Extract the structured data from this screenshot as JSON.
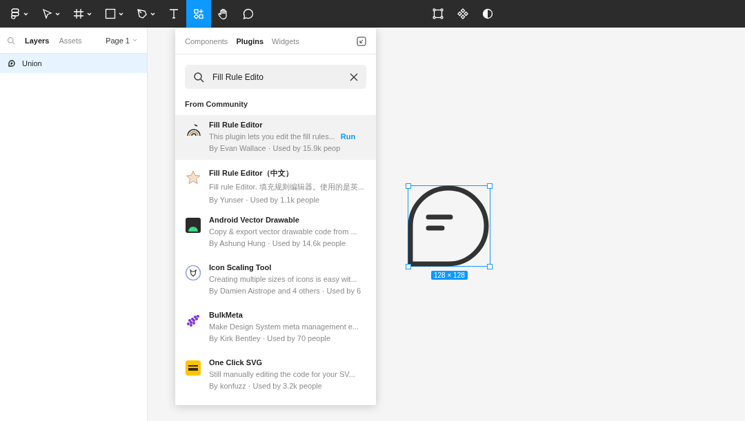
{
  "toolbar": {
    "tools": [
      {
        "kind": "figma",
        "selected": false,
        "caret": true
      },
      {
        "kind": "move",
        "selected": false,
        "caret": true
      },
      {
        "kind": "frame",
        "selected": false,
        "caret": true
      },
      {
        "kind": "rect",
        "selected": false,
        "caret": true
      },
      {
        "kind": "pen",
        "selected": false,
        "caret": true
      },
      {
        "kind": "text",
        "selected": false,
        "caret": false
      },
      {
        "kind": "resources",
        "selected": true,
        "caret": false
      },
      {
        "kind": "hand",
        "selected": false,
        "caret": false
      },
      {
        "kind": "comment",
        "selected": false,
        "caret": false
      }
    ],
    "center": [
      {
        "kind": "edit"
      },
      {
        "kind": "component"
      },
      {
        "kind": "mask"
      }
    ]
  },
  "sidebar": {
    "tabs": [
      {
        "label": "Layers",
        "selected": true
      },
      {
        "label": "Assets",
        "selected": false
      }
    ],
    "page": "Page 1",
    "layers": [
      {
        "name": "Union",
        "selected": true
      }
    ]
  },
  "popup": {
    "tabs": [
      {
        "label": "Components",
        "selected": false
      },
      {
        "label": "Plugins",
        "selected": true
      },
      {
        "label": "Widgets",
        "selected": false
      }
    ],
    "search": {
      "value": "Fill Rule Edito"
    },
    "section": "From Community",
    "plugins": [
      {
        "kind": "rings",
        "name": "Fill Rule Editor",
        "description": "This plugin lets you edit the fill rules...",
        "meta": "By Evan Wallace · Used by 15.9k peop",
        "selected": true,
        "action": "Run"
      },
      {
        "kind": "star",
        "name": "Fill Rule Editor（中文）",
        "description": "Fill rule Editor. 填充规则编辑器。使用的是英...",
        "meta": "By Yunser · Used by 1.1k people",
        "selected": false
      },
      {
        "kind": "android",
        "name": "Android Vector Drawable",
        "description": "Copy & export vector drawable code from ...",
        "meta": "By Ashung Hung · Used by 14.6k people",
        "selected": false
      },
      {
        "kind": "badge",
        "name": "Icon Scaling Tool",
        "description": "Creating multiple sizes of icons is easy wit...",
        "meta": "By Damien Aistrope and 4 others · Used by 6",
        "selected": false
      },
      {
        "kind": "dots",
        "name": "BulkMeta",
        "description": "Make Design System meta management e...",
        "meta": "By Kirk Bentley · Used by 70 people",
        "selected": false
      },
      {
        "kind": "yellow",
        "name": "One Click SVG",
        "description": "Still manually editing the code for your SV...",
        "meta": "By konfuzz · Used by 3.2k people",
        "selected": false
      }
    ]
  },
  "canvas": {
    "selection": {
      "size": "128 × 128"
    }
  }
}
